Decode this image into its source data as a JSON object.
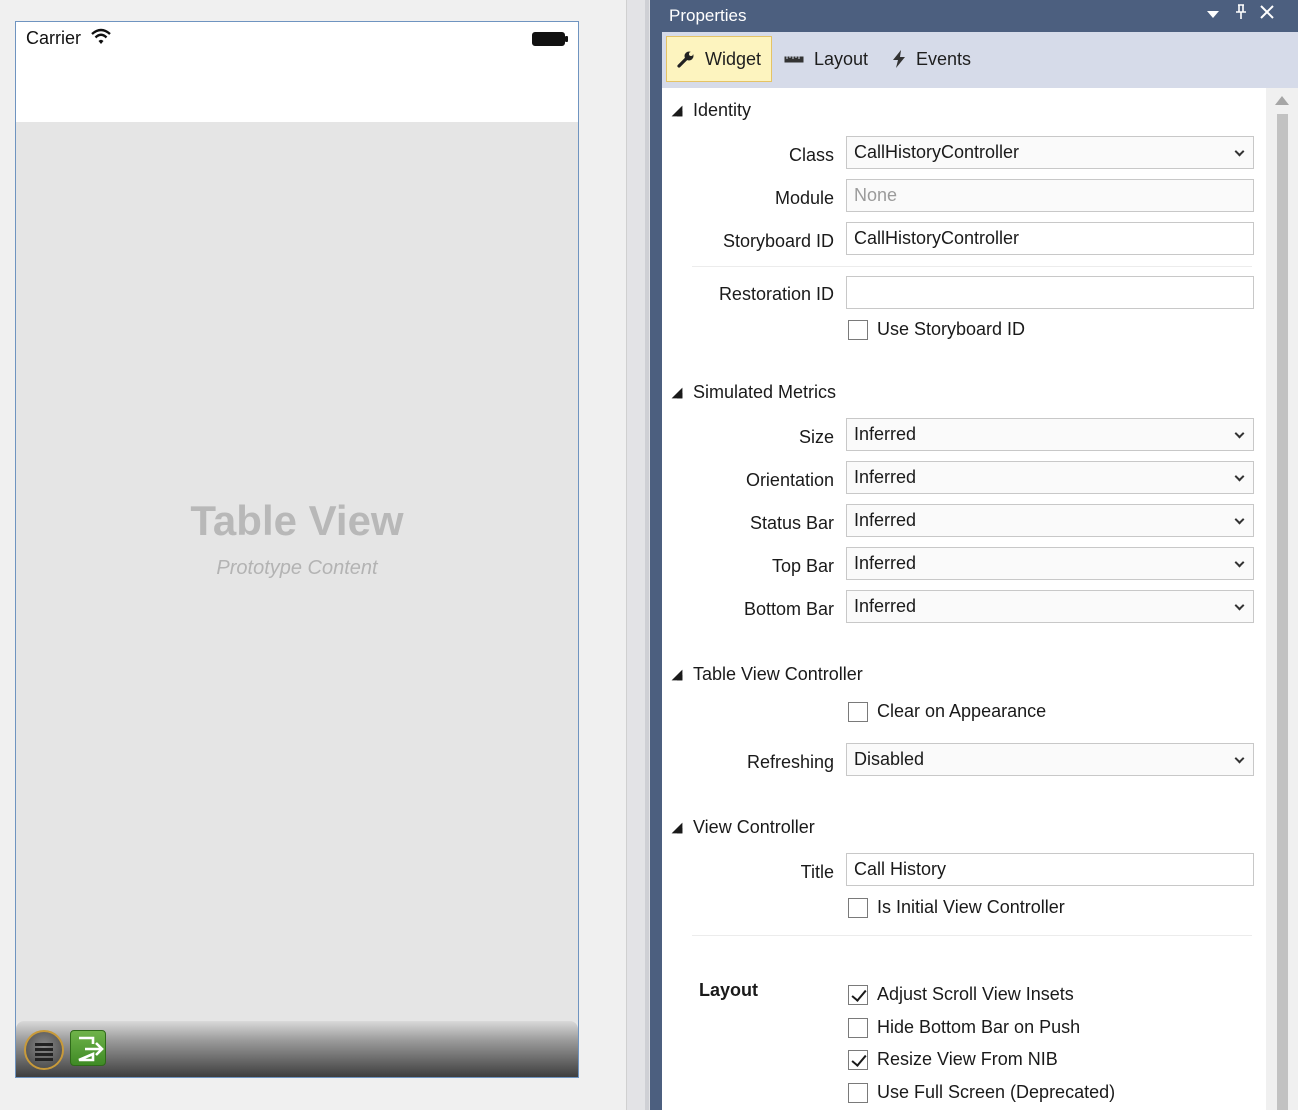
{
  "canvas": {
    "carrier": "Carrier",
    "table_view_title": "Table View",
    "table_view_subtitle": "Prototype Content"
  },
  "pad": {
    "title": "Properties",
    "header_icons": [
      "dropdown-arrow-icon",
      "pin-icon",
      "close-icon"
    ],
    "tabs": [
      {
        "label": "Widget",
        "icon": "wrench-icon",
        "active": true
      },
      {
        "label": "Layout",
        "icon": "ruler-icon",
        "active": false
      },
      {
        "label": "Events",
        "icon": "lightning-icon",
        "active": false
      }
    ]
  },
  "identity": {
    "heading": "Identity",
    "class_label": "Class",
    "class_value": "CallHistoryController",
    "module_label": "Module",
    "module_placeholder": "None",
    "storyboard_id_label": "Storyboard ID",
    "storyboard_id_value": "CallHistoryController",
    "restoration_id_label": "Restoration ID",
    "restoration_id_value": "",
    "use_storyboard_id_label": "Use Storyboard ID",
    "use_storyboard_id_checked": false
  },
  "simulated_metrics": {
    "heading": "Simulated Metrics",
    "size_label": "Size",
    "size_value": "Inferred",
    "orientation_label": "Orientation",
    "orientation_value": "Inferred",
    "status_bar_label": "Status Bar",
    "status_bar_value": "Inferred",
    "top_bar_label": "Top Bar",
    "top_bar_value": "Inferred",
    "bottom_bar_label": "Bottom Bar",
    "bottom_bar_value": "Inferred"
  },
  "table_view_controller": {
    "heading": "Table View Controller",
    "clear_on_appearance_label": "Clear on Appearance",
    "clear_on_appearance_checked": false,
    "refreshing_label": "Refreshing",
    "refreshing_value": "Disabled"
  },
  "view_controller": {
    "heading": "View Controller",
    "title_label": "Title",
    "title_value": "Call History",
    "is_initial_label": "Is Initial View Controller",
    "is_initial_checked": false
  },
  "layout": {
    "heading": "Layout",
    "adjust_scroll_label": "Adjust Scroll View Insets",
    "adjust_scroll_checked": true,
    "hide_bottom_bar_label": "Hide Bottom Bar on Push",
    "hide_bottom_bar_checked": false,
    "resize_from_nib_label": "Resize View From NIB",
    "resize_from_nib_checked": true,
    "use_full_screen_label": "Use Full Screen (Deprecated)",
    "use_full_screen_checked": false
  },
  "colors": {
    "pad_header": "#4c5f7f",
    "tab_bar": "#d6dbe9",
    "active_tab": "#fdf4bf",
    "phone_border": "#6f94c0",
    "dock_exit_green": "#4f9a30"
  }
}
